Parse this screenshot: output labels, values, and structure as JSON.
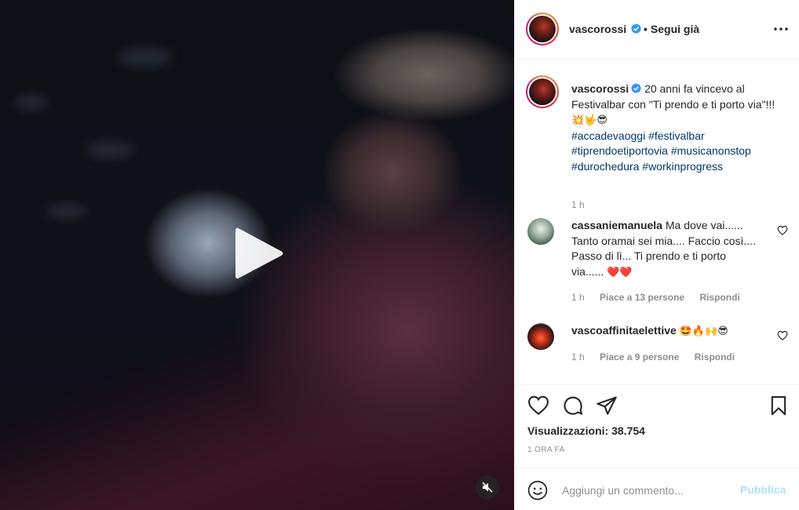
{
  "post": {
    "author": "vascorossi",
    "follow_label": "Segui già",
    "caption_text": "20 anni fa vincevo al Festivalbar con \"Ti prendo e ti porto via\"!!!",
    "caption_emojis": "💥🤟😎",
    "hashtags_line1": "#accadevaoggi #festivalbar",
    "hashtags_line2": "#tiprendoetiportovia #musicanonstop",
    "hashtags_line3": "#durochedura #workinprogress",
    "caption_time": "1 h"
  },
  "comments": [
    {
      "username": "cassaniemanuela",
      "text": "Ma dove vai...... Tanto oramai sei mia.... Faccio così.... Passo di lì... Ti prendo e ti porto via......",
      "emojis": "❤️❤️",
      "time": "1 h",
      "likes": "Piace a 13 persone",
      "reply": "Rispondi"
    },
    {
      "username": "vascoaffinitaelettive",
      "text": "",
      "emojis": "🤩🔥🙌😎",
      "time": "1 h",
      "likes": "Piace a 9 persone",
      "reply": "Rispondi"
    }
  ],
  "stats": {
    "views_label": "Visualizzazioni:",
    "views_count": "38.754",
    "post_time": "1 ORA FA"
  },
  "add_comment": {
    "placeholder": "Aggiungi un commento...",
    "publish_label": "Pubblica"
  },
  "colors": {
    "hashtag": "#00376b",
    "verified": "#3897f0",
    "publish_disabled": "#b2dffc"
  }
}
